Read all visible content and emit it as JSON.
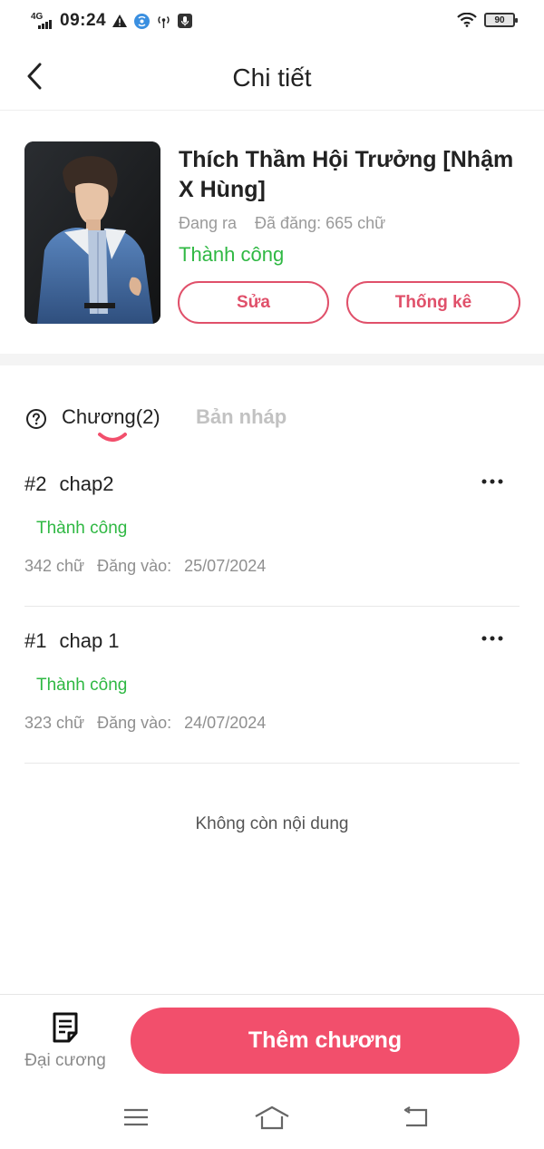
{
  "status_bar": {
    "network": "4G",
    "time": "09:24",
    "battery": "90",
    "icons": [
      "signal-bars-icon",
      "warning-icon",
      "hotspot-icon",
      "antenna-icon",
      "mic-icon",
      "wifi-icon",
      "battery-icon"
    ]
  },
  "header": {
    "title": "Chi tiết",
    "back_icon": "chevron-left-icon"
  },
  "book": {
    "title": "Thích Thầm Hội Trưởng [Nhậm X Hùng]",
    "state": "Đang ra",
    "word_count": "Đã đăng: 665 chữ",
    "publish_status": "Thành công",
    "edit_label": "Sửa",
    "stats_label": "Thống kê"
  },
  "tabs": {
    "help_icon": "question-circle-icon",
    "chapters_label": "Chương(2)",
    "drafts_label": "Bản nháp"
  },
  "chapters": [
    {
      "num": "#2",
      "name": "chap2",
      "status": "Thành công",
      "words": "342 chữ",
      "posted_label": "Đăng vào:",
      "date": "25/07/2024"
    },
    {
      "num": "#1",
      "name": "chap 1",
      "status": "Thành công",
      "words": "323 chữ",
      "posted_label": "Đăng vào:",
      "date": "24/07/2024"
    }
  ],
  "list_end": "Không còn nội dung",
  "bottom_bar": {
    "outline_label": "Đại cương",
    "add_chapter_label": "Thêm chương"
  },
  "colors": {
    "accent": "#f24f6c",
    "success": "#2fb843",
    "outline": "#e0506a"
  }
}
